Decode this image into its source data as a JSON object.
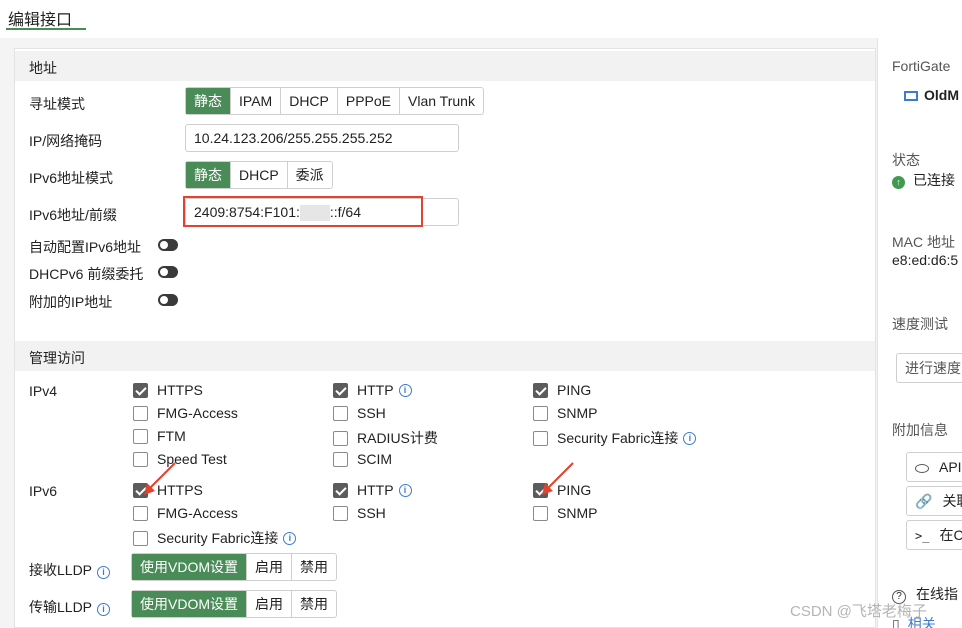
{
  "header": {
    "title": "编辑接口"
  },
  "address": {
    "section_title": "地址",
    "addressing_mode_label": "寻址模式",
    "addressing_modes": [
      "静态",
      "IPAM",
      "DHCP",
      "PPPoE",
      "Vlan Trunk"
    ],
    "ip_mask_label": "IP/网络掩码",
    "ip_mask_value": "10.24.123.206/255.255.255.252",
    "ipv6_mode_label": "IPv6地址模式",
    "ipv6_modes": [
      "静态",
      "DHCP",
      "委派"
    ],
    "ipv6_prefix_label": "IPv6地址/前缀",
    "ipv6_prefix_part1": "2409:8754:F101:",
    "ipv6_prefix_part2": "::f/64",
    "auto_ipv6_label": "自动配置IPv6地址",
    "dhcpv6_label": "DHCPv6 前缀委托",
    "extra_ip_label": "附加的IP地址"
  },
  "admin": {
    "section_title": "管理访问",
    "ipv4_label": "IPv4",
    "ipv6_label": "IPv6",
    "ipv4": {
      "https": "HTTPS",
      "http": "HTTP",
      "ping": "PING",
      "fmg": "FMG-Access",
      "ssh": "SSH",
      "snmp": "SNMP",
      "ftm": "FTM",
      "radius": "RADIUS计费",
      "fabric": "Security Fabric连接",
      "speed": "Speed Test",
      "scim": "SCIM"
    },
    "ipv6": {
      "https": "HTTPS",
      "http": "HTTP",
      "ping": "PING",
      "fmg": "FMG-Access",
      "ssh": "SSH",
      "snmp": "SNMP",
      "fabric": "Security Fabric连接"
    },
    "recv_lldp_label": "接收LLDP",
    "send_lldp_label": "传输LLDP",
    "lldp_options": [
      "使用VDOM设置",
      "启用",
      "禁用"
    ]
  },
  "sidebar": {
    "product": "FortiGate",
    "device_name": "OldM",
    "status_label": "状态",
    "status_value": "已连接",
    "mac_label": "MAC 地址",
    "mac_value": "e8:ed:d6:5",
    "speed_label": "速度测试",
    "speed_button": "进行速度",
    "extra_label": "附加信息",
    "api_button": "API",
    "related_button": "关联",
    "cli_button": "在C",
    "online_help": "在线指",
    "related_link": "相关"
  },
  "watermark": "CSDN @飞塔老梅子",
  "colors": {
    "accent": "#4a8c57",
    "highlight": "#e0432f",
    "info": "#3c7bd0"
  }
}
